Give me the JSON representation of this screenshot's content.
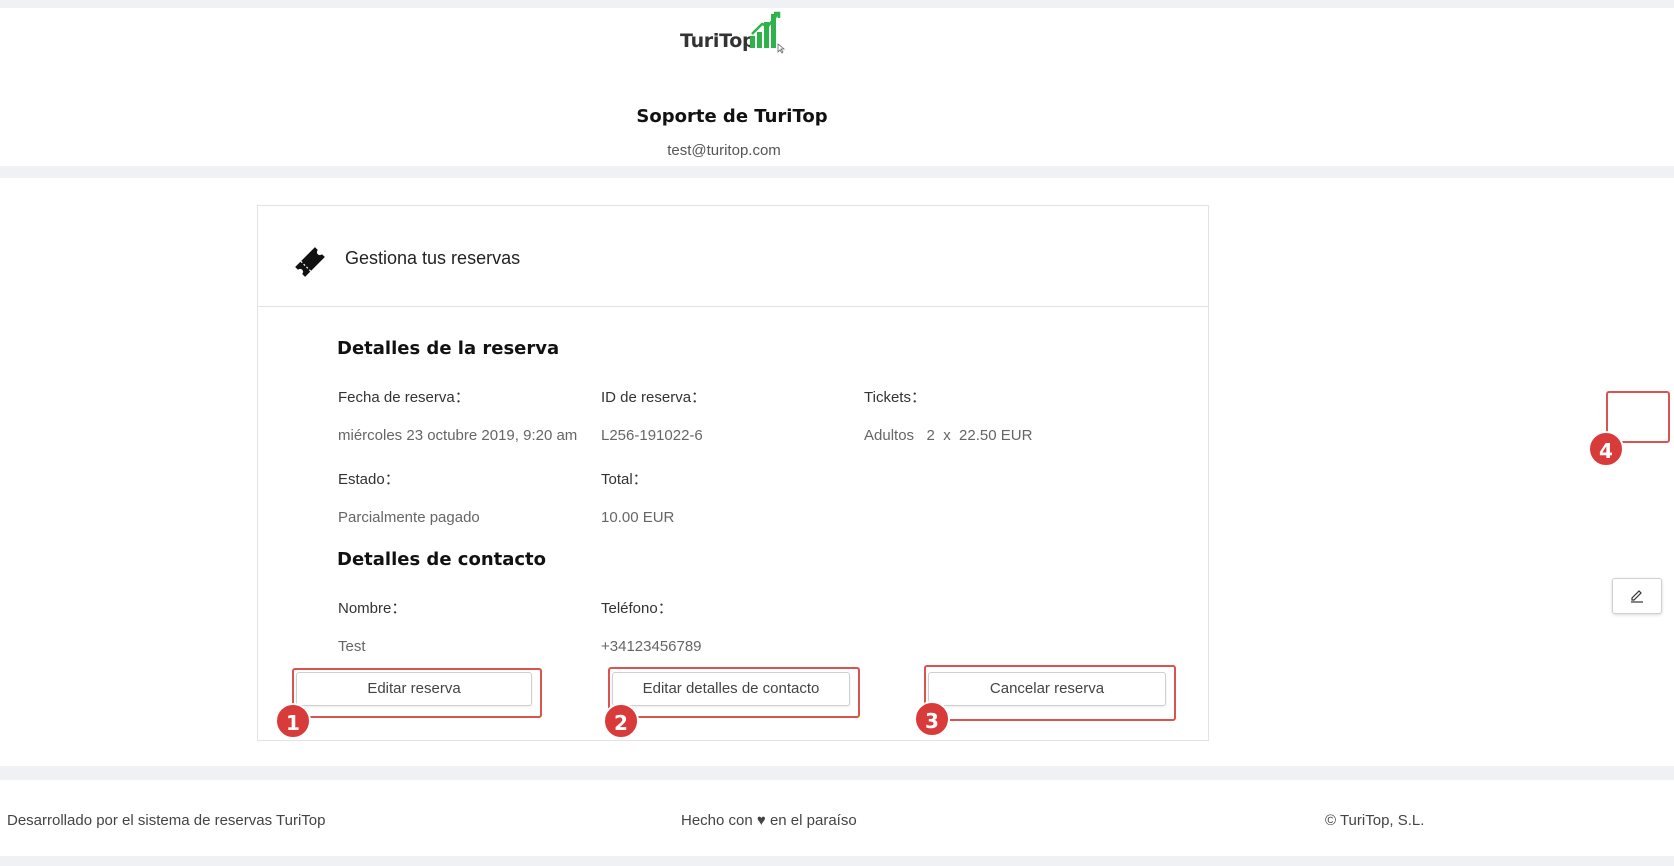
{
  "header": {
    "logo_text": "TuriTop",
    "site_title": "Soporte de TuriTop",
    "site_email": "test@turitop.com"
  },
  "card": {
    "title": "Gestiona tus reservas",
    "booking_section": {
      "title": "Detalles de la reserva",
      "date_label": "Fecha de reserva：",
      "date_value": "miércoles 23 octubre 2019, 9:20 am",
      "id_label": "ID de reserva：",
      "id_value": "L256-191022-6",
      "tickets_label": "Tickets：",
      "tickets_value": "Adultos   2  x  22.50 EUR",
      "status_label": "Estado：",
      "status_value": "Parcialmente pagado",
      "total_label": "Total：",
      "total_value": "10.00 EUR"
    },
    "contact_section": {
      "title": "Detalles de contacto",
      "name_label": "Nombre：",
      "name_value": "Test",
      "phone_label": "Teléfono：",
      "phone_value": "+34123456789"
    },
    "buttons": {
      "edit_booking": "Editar reserva",
      "edit_contact": "Editar detalles de contacto",
      "cancel_booking": "Cancelar reserva"
    }
  },
  "annotations": [
    "1",
    "2",
    "3",
    "4"
  ],
  "icons": {
    "ticket": "ticket-icon",
    "edit": "pencil-icon"
  },
  "colors": {
    "highlight": "#d9534f",
    "badge": "#d93a3a",
    "logo_green": "#2db34a"
  },
  "footer": {
    "left": "Desarrollado por el sistema de reservas TuriTop",
    "center": "Hecho con ♥ en el paraíso",
    "right": "© TuriTop, S.L."
  }
}
